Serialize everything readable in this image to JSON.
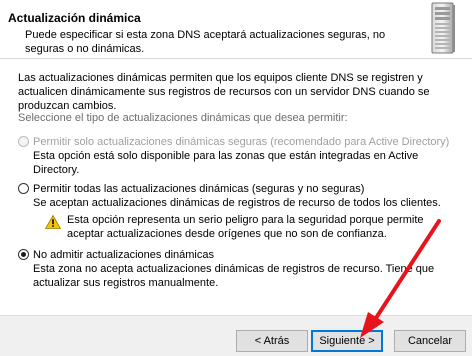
{
  "header": {
    "title": "Actualización dinámica",
    "subtitle": "Puede especificar si esta zona DNS aceptará actualizaciones seguras, no seguras o no dinámicas."
  },
  "main": {
    "intro": "Las actualizaciones dinámicas permiten que los equipos cliente DNS se registren y actualicen dinámicamente sus registros de recursos con un servidor DNS cuando se produzcan cambios.",
    "prompt": "Seleccione el tipo de actualizaciones dinámicas que desea permitir:",
    "options": [
      {
        "label": "Permitir solo actualizaciones dinámicas seguras (recomendado para Active Directory)",
        "description": "Esta opción está solo disponible para las zonas que están integradas en Active Directory.",
        "checked": false,
        "enabled": false
      },
      {
        "label": "Permitir todas las actualizaciones dinámicas (seguras y no seguras)",
        "description": "Se aceptan actualizaciones dinámicas de registros de recurso de todos los clientes.",
        "checked": false,
        "enabled": true
      },
      {
        "label": "No admitir actualizaciones dinámicas",
        "description": "Esta zona no acepta actualizaciones dinámicas de registros de recurso. Tiene que actualizar sus registros manualmente.",
        "checked": true,
        "enabled": true
      }
    ],
    "warning": "Esta opción representa un serio peligro para la seguridad porque permite aceptar actualizaciones desde orígenes que no son de confianza."
  },
  "footer": {
    "back_label": "< Atrás",
    "next_label": "Siguiente >",
    "cancel_label": "Cancelar"
  },
  "colors": {
    "accent": "#0078d7",
    "annotation_arrow": "#e8141c",
    "warning_icon": "#f2c500"
  },
  "icons": [
    "server-tower-icon",
    "warning-icon",
    "annotation-arrow"
  ]
}
